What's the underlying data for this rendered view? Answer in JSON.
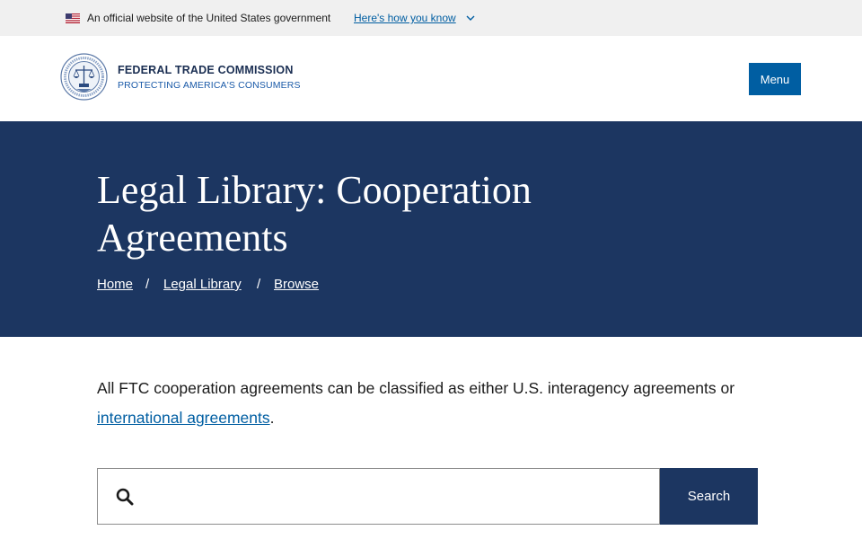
{
  "gov_banner": {
    "text": "An official website of the United States government",
    "link": "Here's how you know"
  },
  "header": {
    "org_name": "FEDERAL TRADE COMMISSION",
    "tagline": "PROTECTING AMERICA'S CONSUMERS",
    "menu_label": "Menu"
  },
  "hero": {
    "title": "Legal Library: Cooperation Agreements",
    "breadcrumbs": [
      "Home",
      "Legal Library",
      "Browse"
    ],
    "separator": "/"
  },
  "intro": {
    "text_before": "All FTC cooperation agreements can be classified as either U.S. interagency agreements or ",
    "link": "international agreements",
    "text_after": "."
  },
  "search": {
    "value": "",
    "button_label": "Search"
  },
  "colors": {
    "navy": "#1c3661",
    "link_blue": "#005ea2",
    "banner_gray": "#f0f0f0"
  }
}
